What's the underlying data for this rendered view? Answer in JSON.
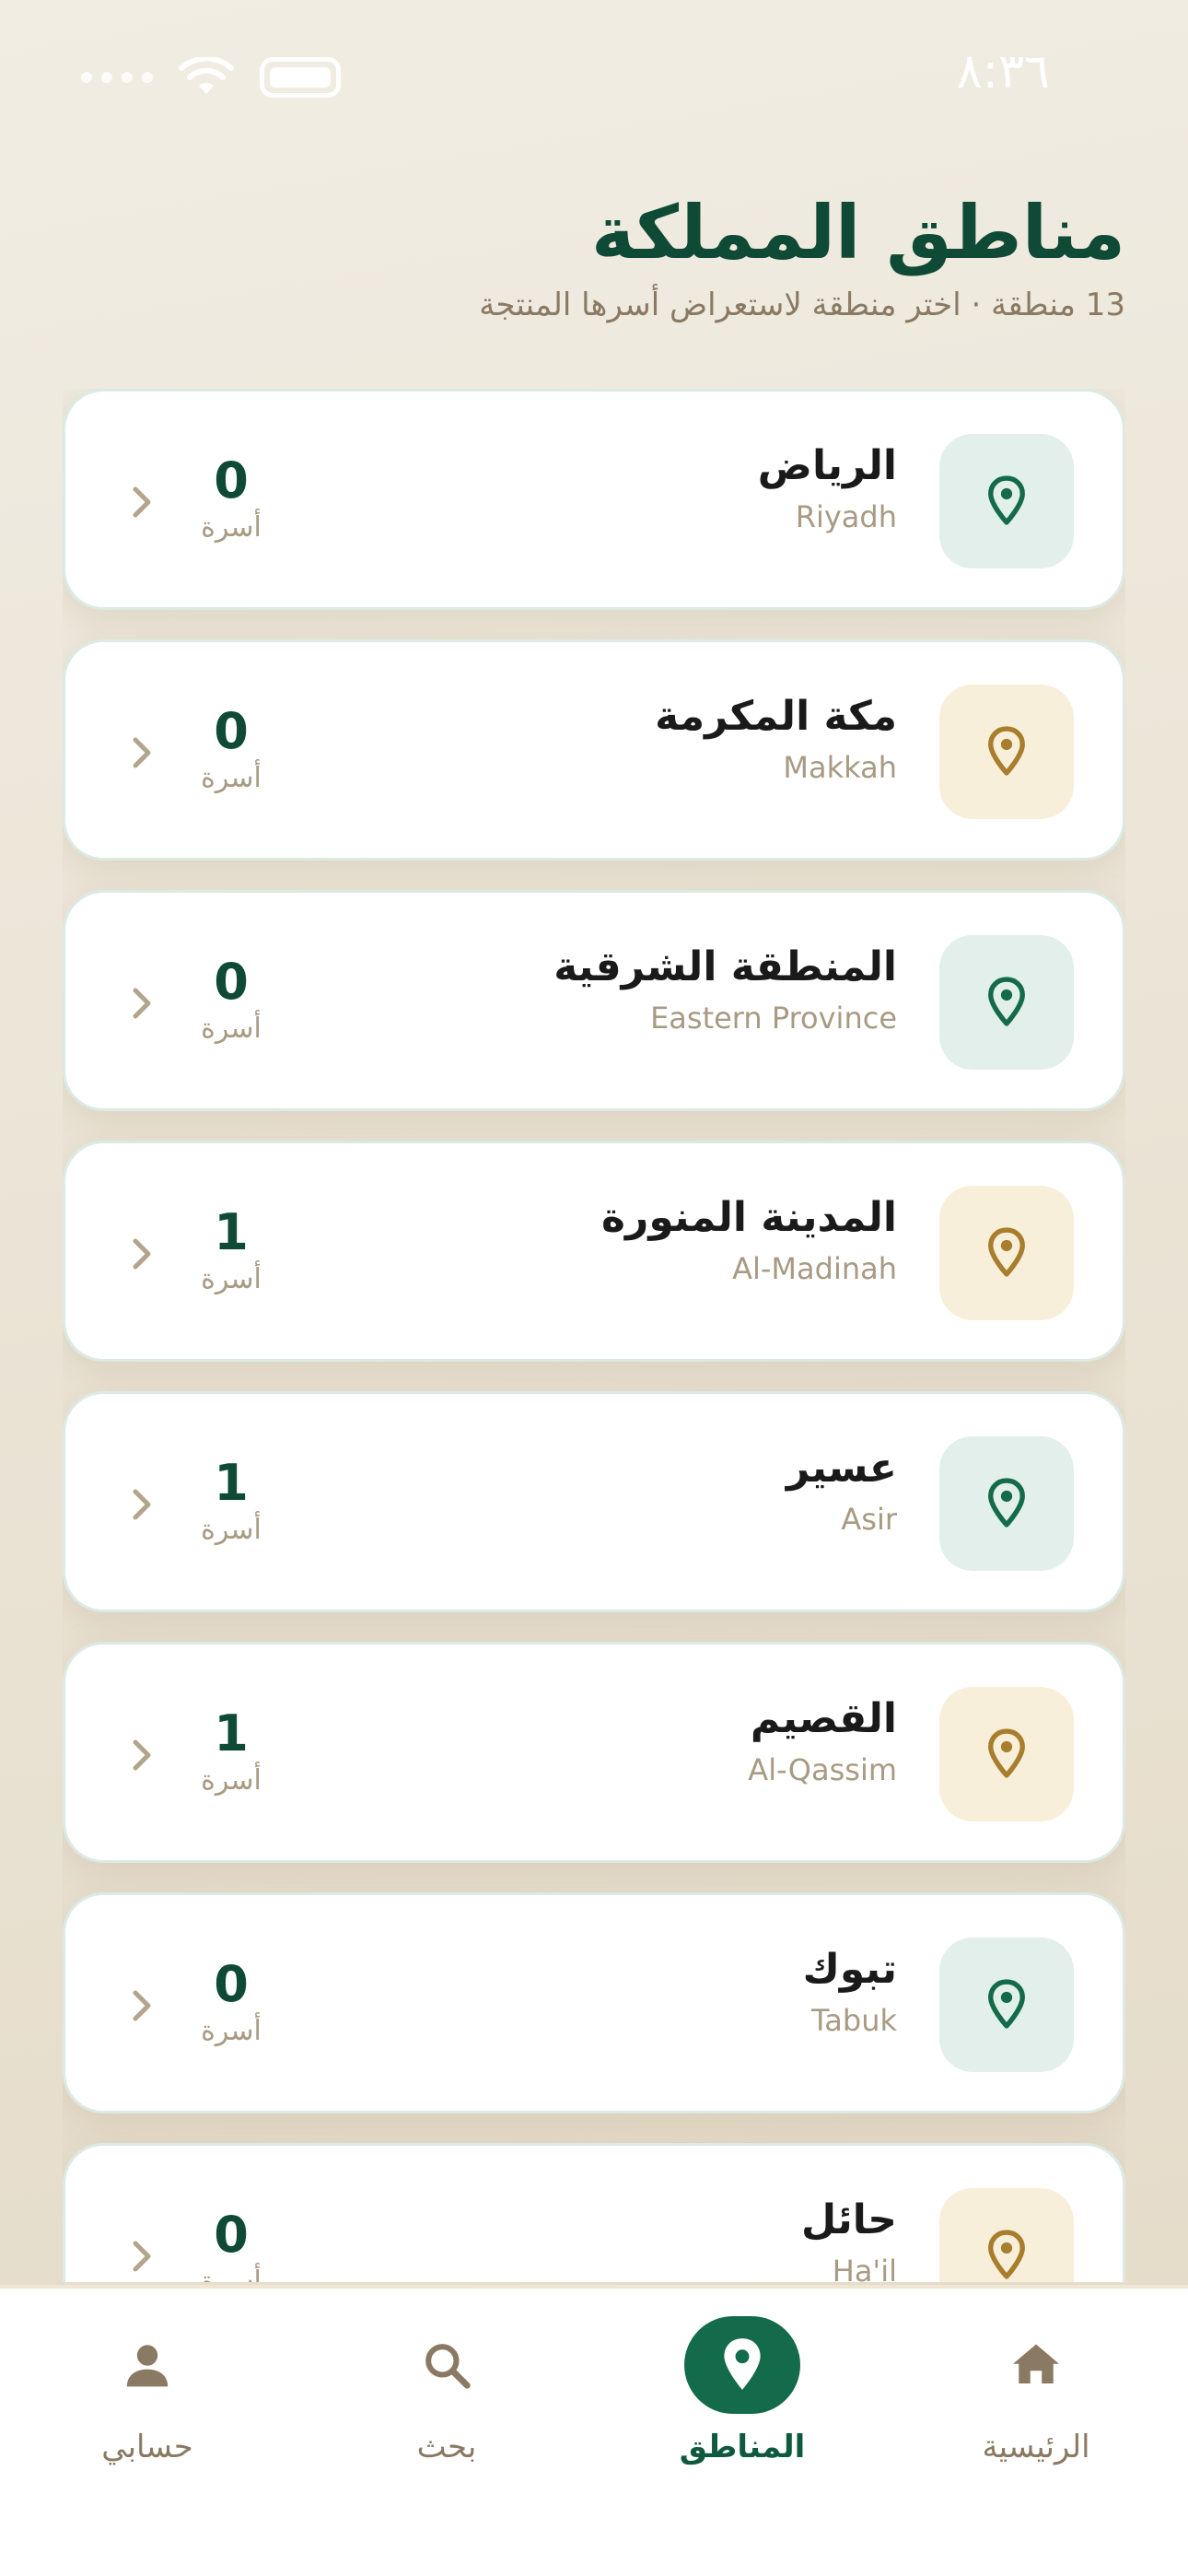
{
  "status_bar": {
    "time": "٨:٣٦"
  },
  "header": {
    "title": "مناطق المملكة",
    "subtitle": "13 منطقة · اختر منطقة لاستعراض أسرها المنتجة"
  },
  "regions": [
    {
      "name": "الرياض",
      "name_en": "Riyadh",
      "count": "0",
      "count_label": "أسرة",
      "icon_color": "#136b4b",
      "icon": "location-pin-icon"
    },
    {
      "name": "مكة المكرمة",
      "name_en": "Makkah",
      "count": "0",
      "count_label": "أسرة",
      "icon_color": "#a87d2c",
      "icon": "location-pin-icon"
    },
    {
      "name": "المنطقة الشرقية",
      "name_en": "Eastern Province",
      "count": "0",
      "count_label": "أسرة",
      "icon_color": "#136b4b",
      "icon": "location-pin-icon"
    },
    {
      "name": "المدينة المنورة",
      "name_en": "Al-Madinah",
      "count": "1",
      "count_label": "أسرة",
      "icon_color": "#a87d2c",
      "icon": "location-pin-icon"
    },
    {
      "name": "عسير",
      "name_en": "Asir",
      "count": "1",
      "count_label": "أسرة",
      "icon_color": "#136b4b",
      "icon": "location-pin-icon"
    },
    {
      "name": "القصيم",
      "name_en": "Al-Qassim",
      "count": "1",
      "count_label": "أسرة",
      "icon_color": "#a87d2c",
      "icon": "location-pin-icon"
    },
    {
      "name": "تبوك",
      "name_en": "Tabuk",
      "count": "0",
      "count_label": "أسرة",
      "icon_color": "#136b4b",
      "icon": "location-pin-icon"
    },
    {
      "name": "حائل",
      "name_en": "Ha'il",
      "count": "0",
      "count_label": "أسرة",
      "icon_color": "#a87d2c",
      "icon": "location-pin-icon"
    }
  ],
  "bottom_nav": {
    "items": [
      {
        "label": "الرئيسية",
        "icon": "home-icon",
        "active": false
      },
      {
        "label": "المناطق",
        "icon": "location-pin-icon",
        "active": true
      },
      {
        "label": "بحث",
        "icon": "search-icon",
        "active": false
      },
      {
        "label": "حسابي",
        "icon": "user-icon",
        "active": false
      }
    ]
  },
  "colors": {
    "primary": "#136b4b",
    "title": "#0f4a36",
    "gold": "#a87d2c",
    "muted": "#a89a83"
  }
}
